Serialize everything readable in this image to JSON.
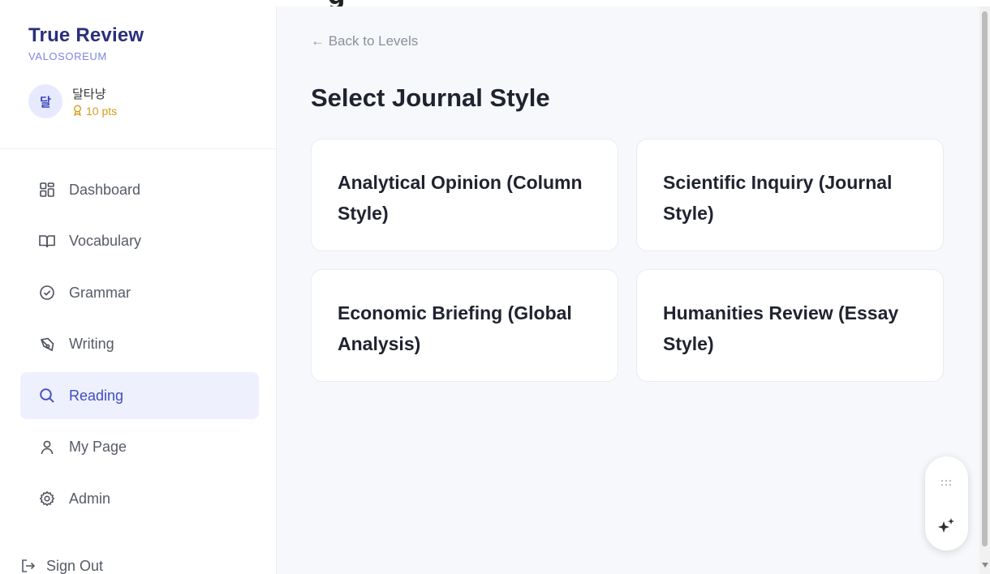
{
  "top_clip": "g",
  "brand": {
    "title": "True Review",
    "subtitle": "VALOSOREUM"
  },
  "user": {
    "avatar_initial": "달",
    "name": "달타냥",
    "points": "10 pts"
  },
  "nav": {
    "items": [
      {
        "label": "Dashboard",
        "icon": "dashboard-icon",
        "active": false
      },
      {
        "label": "Vocabulary",
        "icon": "book-icon",
        "active": false
      },
      {
        "label": "Grammar",
        "icon": "check-circle-icon",
        "active": false
      },
      {
        "label": "Writing",
        "icon": "pen-icon",
        "active": false
      },
      {
        "label": "Reading",
        "icon": "search-icon",
        "active": true
      },
      {
        "label": "My Page",
        "icon": "user-icon",
        "active": false
      },
      {
        "label": "Admin",
        "icon": "gear-icon",
        "active": false
      }
    ],
    "sign_out": "Sign Out"
  },
  "main": {
    "back_link": "← Back to Levels",
    "title": "Select Journal Style",
    "cards": [
      {
        "line1": "Analytical Opinion (Column",
        "line2": "Style)"
      },
      {
        "line1": "Scientific Inquiry (Journal",
        "line2": "Style)"
      },
      {
        "line1": "Economic Briefing (Global",
        "line2": "Analysis)"
      },
      {
        "line1": "Humanities Review (Essay",
        "line2": "Style)"
      }
    ]
  },
  "colors": {
    "brand": "#2b2f7a",
    "accent": "#3f4bc4",
    "active_bg": "#eef0fe",
    "points": "#d79b1b",
    "main_bg": "#f7f8fb"
  }
}
